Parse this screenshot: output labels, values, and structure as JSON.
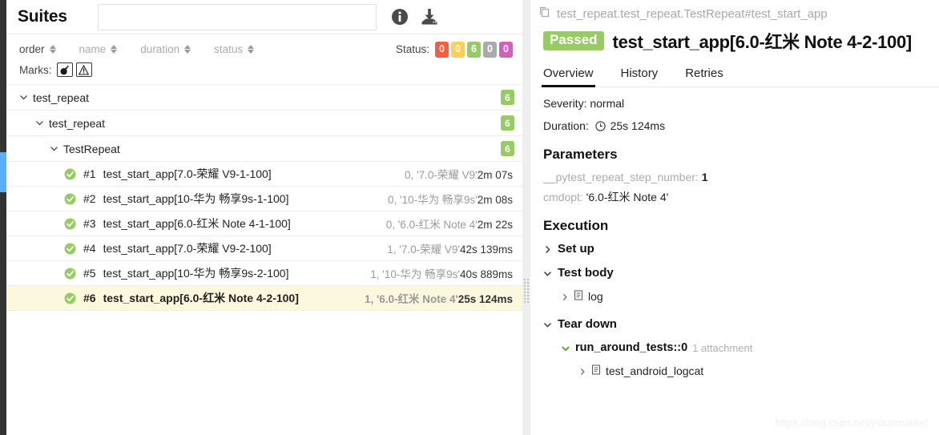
{
  "left_panel": {
    "title": "Suites",
    "search": {
      "value": "",
      "placeholder": ""
    },
    "icons": {
      "info": "info-icon",
      "download": "download-icon"
    },
    "sort_columns": [
      {
        "label": "order",
        "active": true
      },
      {
        "label": "name",
        "active": false
      },
      {
        "label": "duration",
        "active": false
      },
      {
        "label": "status",
        "active": false
      }
    ],
    "status_filter": {
      "label": "Status:",
      "chips": [
        {
          "value": "0",
          "color": "#fd5a3e",
          "name": "failed"
        },
        {
          "value": "0",
          "color": "#ffd050",
          "name": "broken"
        },
        {
          "value": "6",
          "color": "#97cc64",
          "name": "passed"
        },
        {
          "value": "0",
          "color": "#aaaaaa",
          "name": "skipped"
        },
        {
          "value": "0",
          "color": "#d35ebe",
          "name": "unknown"
        }
      ]
    },
    "marks": {
      "label": "Marks:",
      "chips": [
        {
          "name": "flaky-bomb-icon",
          "glyph": "💣"
        },
        {
          "name": "warning-triangle-icon",
          "glyph": "⚠"
        }
      ]
    },
    "tree": [
      {
        "level": 0,
        "label": "test_repeat",
        "badge": "6",
        "expanded": true
      },
      {
        "level": 1,
        "label": "test_repeat",
        "badge": "6",
        "expanded": true
      },
      {
        "level": 2,
        "label": "TestRepeat",
        "badge": "6",
        "expanded": true
      }
    ],
    "tests": [
      {
        "num": "#1",
        "name": "test_start_app[7.0-荣耀 V9-1-100]",
        "param": "0, '7.0-荣耀 V9'",
        "duration": "2m 07s",
        "status": "passed",
        "selected": false
      },
      {
        "num": "#2",
        "name": "test_start_app[10-华为 畅享9s-1-100]",
        "param": "0, '10-华为 畅享9s'",
        "duration": "2m 08s",
        "status": "passed",
        "selected": false
      },
      {
        "num": "#3",
        "name": "test_start_app[6.0-红米 Note 4-1-100]",
        "param": "0, '6.0-红米 Note 4'",
        "duration": "2m 22s",
        "status": "passed",
        "selected": false
      },
      {
        "num": "#4",
        "name": "test_start_app[7.0-荣耀 V9-2-100]",
        "param": "1, '7.0-荣耀 V9'",
        "duration": "42s 139ms",
        "status": "passed",
        "selected": false
      },
      {
        "num": "#5",
        "name": "test_start_app[10-华为 畅享9s-2-100]",
        "param": "1, '10-华为 畅享9s'",
        "duration": "40s 889ms",
        "status": "passed",
        "selected": false
      },
      {
        "num": "#6",
        "name": "test_start_app[6.0-红米 Note 4-2-100]",
        "param": "1, '6.0-红米 Note 4'",
        "duration": "25s 124ms",
        "status": "passed",
        "selected": true
      }
    ]
  },
  "right_panel": {
    "breadcrumb": "test_repeat.test_repeat.TestRepeat#test_start_app",
    "status_badge": "Passed",
    "title": "test_start_app[6.0-红米 Note 4-2-100]",
    "tabs": [
      {
        "label": "Overview",
        "active": true
      },
      {
        "label": "History",
        "active": false
      },
      {
        "label": "Retries",
        "active": false
      }
    ],
    "severity": "Severity: normal",
    "duration_label": "Duration:",
    "duration_value": "25s 124ms",
    "parameters_heading": "Parameters",
    "parameters": [
      {
        "key": "__pytest_repeat_step_number:",
        "value": "1",
        "bold": true
      },
      {
        "key": "cmdopt:",
        "value": "'6.0-红米 Note 4'",
        "bold": false
      }
    ],
    "execution_heading": "Execution",
    "execution": {
      "set_up": {
        "label": "Set up",
        "expanded": false
      },
      "test_body": {
        "label": "Test body",
        "expanded": true,
        "children": [
          {
            "label": "log",
            "expanded": false
          }
        ]
      },
      "tear_down": {
        "label": "Tear down",
        "expanded": true,
        "fixture": {
          "label": "run_around_tests::0",
          "attachment_note": "1 attachment",
          "expanded": true,
          "children": [
            {
              "label": "test_android_logcat",
              "expanded": false
            }
          ]
        }
      }
    }
  },
  "watermark": "https://blog.csdn.net/yidunmarket",
  "theme": {
    "green": "#97cc64",
    "selected_row_bg": "#fbf8dd",
    "rail_bg": "#333333",
    "rail_indicator": "#5aaefb"
  }
}
